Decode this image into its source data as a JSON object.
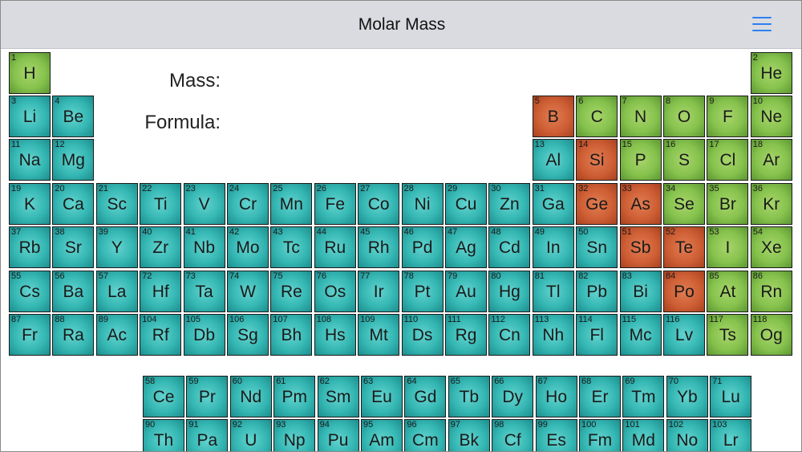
{
  "app": {
    "title": "Molar Mass",
    "menu_icon": "hamburger-menu-icon"
  },
  "form": {
    "mass_label": "Mass:",
    "formula_label": "Formula:"
  },
  "colors": {
    "metal": "#35b7b3",
    "nonmetal": "#86c24d",
    "metalloid": "#cf5f35",
    "menu_accent": "#2f7ff0"
  },
  "elements": [
    {
      "n": 1,
      "s": "H",
      "t": "nonmetal"
    },
    {
      "n": 2,
      "s": "He",
      "t": "nonmetal"
    },
    {
      "n": 3,
      "s": "Li",
      "t": "metal"
    },
    {
      "n": 4,
      "s": "Be",
      "t": "metal"
    },
    {
      "n": 5,
      "s": "B",
      "t": "metalloid"
    },
    {
      "n": 6,
      "s": "C",
      "t": "nonmetal"
    },
    {
      "n": 7,
      "s": "N",
      "t": "nonmetal"
    },
    {
      "n": 8,
      "s": "O",
      "t": "nonmetal"
    },
    {
      "n": 9,
      "s": "F",
      "t": "nonmetal"
    },
    {
      "n": 10,
      "s": "Ne",
      "t": "nonmetal"
    },
    {
      "n": 11,
      "s": "Na",
      "t": "metal"
    },
    {
      "n": 12,
      "s": "Mg",
      "t": "metal"
    },
    {
      "n": 13,
      "s": "Al",
      "t": "metal"
    },
    {
      "n": 14,
      "s": "Si",
      "t": "metalloid"
    },
    {
      "n": 15,
      "s": "P",
      "t": "nonmetal"
    },
    {
      "n": 16,
      "s": "S",
      "t": "nonmetal"
    },
    {
      "n": 17,
      "s": "Cl",
      "t": "nonmetal"
    },
    {
      "n": 18,
      "s": "Ar",
      "t": "nonmetal"
    },
    {
      "n": 19,
      "s": "K",
      "t": "metal"
    },
    {
      "n": 20,
      "s": "Ca",
      "t": "metal"
    },
    {
      "n": 21,
      "s": "Sc",
      "t": "metal"
    },
    {
      "n": 22,
      "s": "Ti",
      "t": "metal"
    },
    {
      "n": 23,
      "s": "V",
      "t": "metal"
    },
    {
      "n": 24,
      "s": "Cr",
      "t": "metal"
    },
    {
      "n": 25,
      "s": "Mn",
      "t": "metal"
    },
    {
      "n": 26,
      "s": "Fe",
      "t": "metal"
    },
    {
      "n": 27,
      "s": "Co",
      "t": "metal"
    },
    {
      "n": 28,
      "s": "Ni",
      "t": "metal"
    },
    {
      "n": 29,
      "s": "Cu",
      "t": "metal"
    },
    {
      "n": 30,
      "s": "Zn",
      "t": "metal"
    },
    {
      "n": 31,
      "s": "Ga",
      "t": "metal"
    },
    {
      "n": 32,
      "s": "Ge",
      "t": "metalloid"
    },
    {
      "n": 33,
      "s": "As",
      "t": "metalloid"
    },
    {
      "n": 34,
      "s": "Se",
      "t": "nonmetal"
    },
    {
      "n": 35,
      "s": "Br",
      "t": "nonmetal"
    },
    {
      "n": 36,
      "s": "Kr",
      "t": "nonmetal"
    },
    {
      "n": 37,
      "s": "Rb",
      "t": "metal"
    },
    {
      "n": 38,
      "s": "Sr",
      "t": "metal"
    },
    {
      "n": 39,
      "s": "Y",
      "t": "metal"
    },
    {
      "n": 40,
      "s": "Zr",
      "t": "metal"
    },
    {
      "n": 41,
      "s": "Nb",
      "t": "metal"
    },
    {
      "n": 42,
      "s": "Mo",
      "t": "metal"
    },
    {
      "n": 43,
      "s": "Tc",
      "t": "metal"
    },
    {
      "n": 44,
      "s": "Ru",
      "t": "metal"
    },
    {
      "n": 45,
      "s": "Rh",
      "t": "metal"
    },
    {
      "n": 46,
      "s": "Pd",
      "t": "metal"
    },
    {
      "n": 47,
      "s": "Ag",
      "t": "metal"
    },
    {
      "n": 48,
      "s": "Cd",
      "t": "metal"
    },
    {
      "n": 49,
      "s": "In",
      "t": "metal"
    },
    {
      "n": 50,
      "s": "Sn",
      "t": "metal"
    },
    {
      "n": 51,
      "s": "Sb",
      "t": "metalloid"
    },
    {
      "n": 52,
      "s": "Te",
      "t": "metalloid"
    },
    {
      "n": 53,
      "s": "I",
      "t": "nonmetal"
    },
    {
      "n": 54,
      "s": "Xe",
      "t": "nonmetal"
    },
    {
      "n": 55,
      "s": "Cs",
      "t": "metal"
    },
    {
      "n": 56,
      "s": "Ba",
      "t": "metal"
    },
    {
      "n": 57,
      "s": "La",
      "t": "metal"
    },
    {
      "n": 72,
      "s": "Hf",
      "t": "metal"
    },
    {
      "n": 73,
      "s": "Ta",
      "t": "metal"
    },
    {
      "n": 74,
      "s": "W",
      "t": "metal"
    },
    {
      "n": 75,
      "s": "Re",
      "t": "metal"
    },
    {
      "n": 76,
      "s": "Os",
      "t": "metal"
    },
    {
      "n": 77,
      "s": "Ir",
      "t": "metal"
    },
    {
      "n": 78,
      "s": "Pt",
      "t": "metal"
    },
    {
      "n": 79,
      "s": "Au",
      "t": "metal"
    },
    {
      "n": 80,
      "s": "Hg",
      "t": "metal"
    },
    {
      "n": 81,
      "s": "Tl",
      "t": "metal"
    },
    {
      "n": 82,
      "s": "Pb",
      "t": "metal"
    },
    {
      "n": 83,
      "s": "Bi",
      "t": "metal"
    },
    {
      "n": 84,
      "s": "Po",
      "t": "metalloid"
    },
    {
      "n": 85,
      "s": "At",
      "t": "nonmetal"
    },
    {
      "n": 86,
      "s": "Rn",
      "t": "nonmetal"
    },
    {
      "n": 87,
      "s": "Fr",
      "t": "metal"
    },
    {
      "n": 88,
      "s": "Ra",
      "t": "metal"
    },
    {
      "n": 89,
      "s": "Ac",
      "t": "metal"
    },
    {
      "n": 104,
      "s": "Rf",
      "t": "metal"
    },
    {
      "n": 105,
      "s": "Db",
      "t": "metal"
    },
    {
      "n": 106,
      "s": "Sg",
      "t": "metal"
    },
    {
      "n": 107,
      "s": "Bh",
      "t": "metal"
    },
    {
      "n": 108,
      "s": "Hs",
      "t": "metal"
    },
    {
      "n": 109,
      "s": "Mt",
      "t": "metal"
    },
    {
      "n": 110,
      "s": "Ds",
      "t": "metal"
    },
    {
      "n": 111,
      "s": "Rg",
      "t": "metal"
    },
    {
      "n": 112,
      "s": "Cn",
      "t": "metal"
    },
    {
      "n": 113,
      "s": "Nh",
      "t": "metal"
    },
    {
      "n": 114,
      "s": "Fl",
      "t": "metal"
    },
    {
      "n": 115,
      "s": "Mc",
      "t": "metal"
    },
    {
      "n": 116,
      "s": "Lv",
      "t": "metal"
    },
    {
      "n": 117,
      "s": "Ts",
      "t": "nonmetal"
    },
    {
      "n": 118,
      "s": "Og",
      "t": "nonmetal"
    },
    {
      "n": 58,
      "s": "Ce",
      "t": "metal"
    },
    {
      "n": 59,
      "s": "Pr",
      "t": "metal"
    },
    {
      "n": 60,
      "s": "Nd",
      "t": "metal"
    },
    {
      "n": 61,
      "s": "Pm",
      "t": "metal"
    },
    {
      "n": 62,
      "s": "Sm",
      "t": "metal"
    },
    {
      "n": 63,
      "s": "Eu",
      "t": "metal"
    },
    {
      "n": 64,
      "s": "Gd",
      "t": "metal"
    },
    {
      "n": 65,
      "s": "Tb",
      "t": "metal"
    },
    {
      "n": 66,
      "s": "Dy",
      "t": "metal"
    },
    {
      "n": 67,
      "s": "Ho",
      "t": "metal"
    },
    {
      "n": 68,
      "s": "Er",
      "t": "metal"
    },
    {
      "n": 69,
      "s": "Tm",
      "t": "metal"
    },
    {
      "n": 70,
      "s": "Yb",
      "t": "metal"
    },
    {
      "n": 71,
      "s": "Lu",
      "t": "metal"
    },
    {
      "n": 90,
      "s": "Th",
      "t": "metal"
    },
    {
      "n": 91,
      "s": "Pa",
      "t": "metal"
    },
    {
      "n": 92,
      "s": "U",
      "t": "metal"
    },
    {
      "n": 93,
      "s": "Np",
      "t": "metal"
    },
    {
      "n": 94,
      "s": "Pu",
      "t": "metal"
    },
    {
      "n": 95,
      "s": "Am",
      "t": "metal"
    },
    {
      "n": 96,
      "s": "Cm",
      "t": "metal"
    },
    {
      "n": 97,
      "s": "Bk",
      "t": "metal"
    },
    {
      "n": 98,
      "s": "Cf",
      "t": "metal"
    },
    {
      "n": 99,
      "s": "Es",
      "t": "metal"
    },
    {
      "n": 100,
      "s": "Fm",
      "t": "metal"
    },
    {
      "n": 101,
      "s": "Md",
      "t": "metal"
    },
    {
      "n": 102,
      "s": "No",
      "t": "metal"
    },
    {
      "n": 103,
      "s": "Lr",
      "t": "metal"
    }
  ]
}
